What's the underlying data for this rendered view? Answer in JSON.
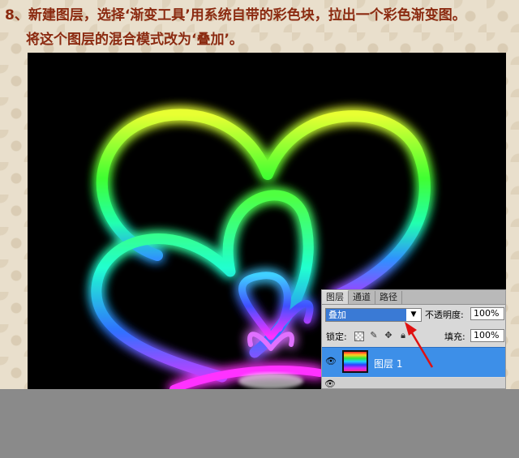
{
  "caption": {
    "line1": "8、新建图层，选择‘渐变工具’用系统自带的彩色块，拉出一个彩色渐变图。",
    "line2": "将这个图层的混合模式改为‘叠加’。"
  },
  "layers_panel": {
    "tabs": [
      "图层",
      "通道",
      "路径"
    ],
    "blend_mode": "叠加",
    "opacity_label": "不透明度:",
    "opacity_value": "100%",
    "lock_label": "锁定:",
    "fill_label": "填充:",
    "fill_value": "100%",
    "layer_name": "图层 1"
  },
  "colors": {
    "caption_text": "#8b2a10",
    "selected_layer": "#3d8fe8",
    "arrow": "#e01010"
  },
  "icons": [
    "eye-icon",
    "lock-transparent-icon",
    "lock-brush-icon",
    "lock-move-icon",
    "lock-all-icon",
    "dropdown-arrow-icon"
  ]
}
